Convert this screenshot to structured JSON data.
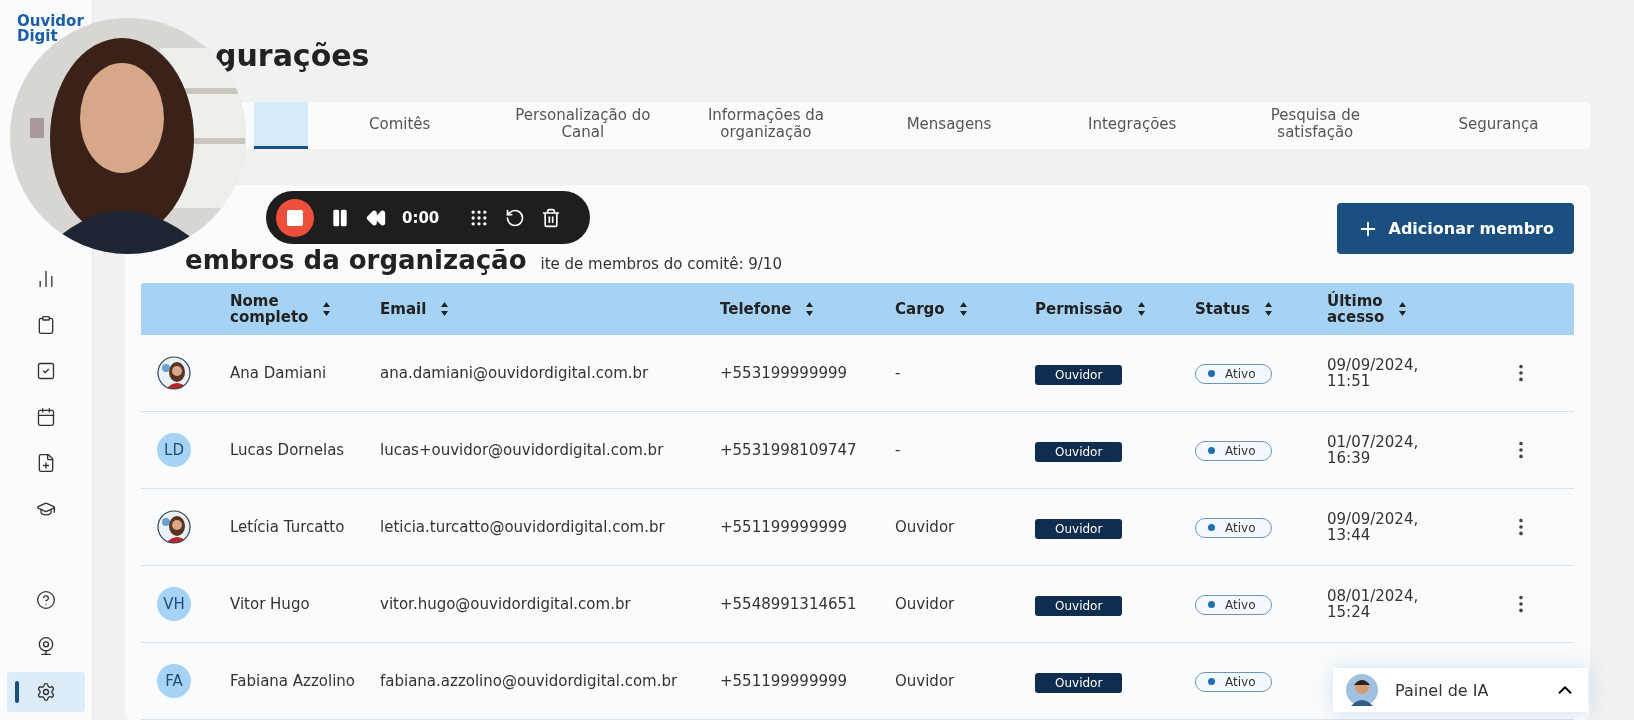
{
  "logo": {
    "line_1": "Ouvidor",
    "line_2": "Digit"
  },
  "sidebar": {
    "items": [
      {
        "kind": "chart",
        "selected": false
      },
      {
        "kind": "clipboard",
        "selected": false
      },
      {
        "kind": "check",
        "selected": false
      },
      {
        "kind": "calendar",
        "selected": false
      },
      {
        "kind": "file",
        "selected": false
      },
      {
        "kind": "course",
        "selected": false
      },
      {
        "kind": "help",
        "selected": false
      },
      {
        "kind": "webcam",
        "selected": false
      },
      {
        "kind": "settings",
        "selected": true
      }
    ]
  },
  "page_title": "gurações",
  "tabs": [
    {
      "selected": true
    },
    {
      "label": "Comitês",
      "selected": false
    },
    {
      "label": "Personalização do Canal",
      "selected": false
    },
    {
      "label": "Informações da organização",
      "selected": false
    },
    {
      "label": "Mensagens",
      "selected": false
    },
    {
      "label": "Integrações",
      "selected": false
    },
    {
      "label": "Pesquisa de satisfação",
      "selected": false
    },
    {
      "label": "Segurança",
      "selected": false
    }
  ],
  "section": {
    "title": "embros da organização",
    "limit": "ite de membros do comitê: 9/10",
    "add_button": "Adicionar membro"
  },
  "table": {
    "columns": [
      "Nome completo",
      "Email",
      "Telefone",
      "Cargo",
      "Permissão",
      "Status",
      "Último acesso"
    ],
    "rows": [
      {
        "name": "Ana Damiani",
        "email": "ana.damiani@ouvidordigital.com.br",
        "phone": "+553199999999",
        "role": "-",
        "permission": "Ouvidor",
        "status": "Ativo",
        "last_access": "09/09/2024, 11:51",
        "menu_visible": true
      },
      {
        "avatar": {
          "kind": "initials",
          "text": "LD"
        },
        "name": "Lucas Dornelas",
        "email": "lucas+ouvidor@ouvidordigital.com.br",
        "phone": "+5531998109747",
        "role": "-",
        "permission": "Ouvidor",
        "status": "Ativo",
        "last_access": "01/07/2024, 16:39",
        "menu_visible": true
      },
      {
        "name": "Letícia Turcatto",
        "email": "leticia.turcatto@ouvidordigital.com.br",
        "phone": "+551199999999",
        "role": "Ouvidor",
        "permission": "Ouvidor",
        "status": "Ativo",
        "last_access": "09/09/2024, 13:44",
        "menu_visible": true
      },
      {
        "avatar": {
          "kind": "initials",
          "text": "VH"
        },
        "name": "Vitor Hugo",
        "email": "vitor.hugo@ouvidordigital.com.br",
        "phone": "+5548991314651",
        "role": "Ouvidor",
        "permission": "Ouvidor",
        "status": "Ativo",
        "last_access": "08/01/2024, 15:24",
        "menu_visible": true
      },
      {
        "avatar": {
          "kind": "initials",
          "text": "FA"
        },
        "name": "Fabiana Azzolino",
        "email": "fabiana.azzolino@ouvidordigital.com.br",
        "phone": "+551199999999",
        "role": "Ouvidor",
        "permission": "Ouvidor",
        "status": "Ativo"
      }
    ]
  },
  "ai_panel": {
    "label": "Painel de IA"
  },
  "recorder": {
    "time": "0:00"
  }
}
